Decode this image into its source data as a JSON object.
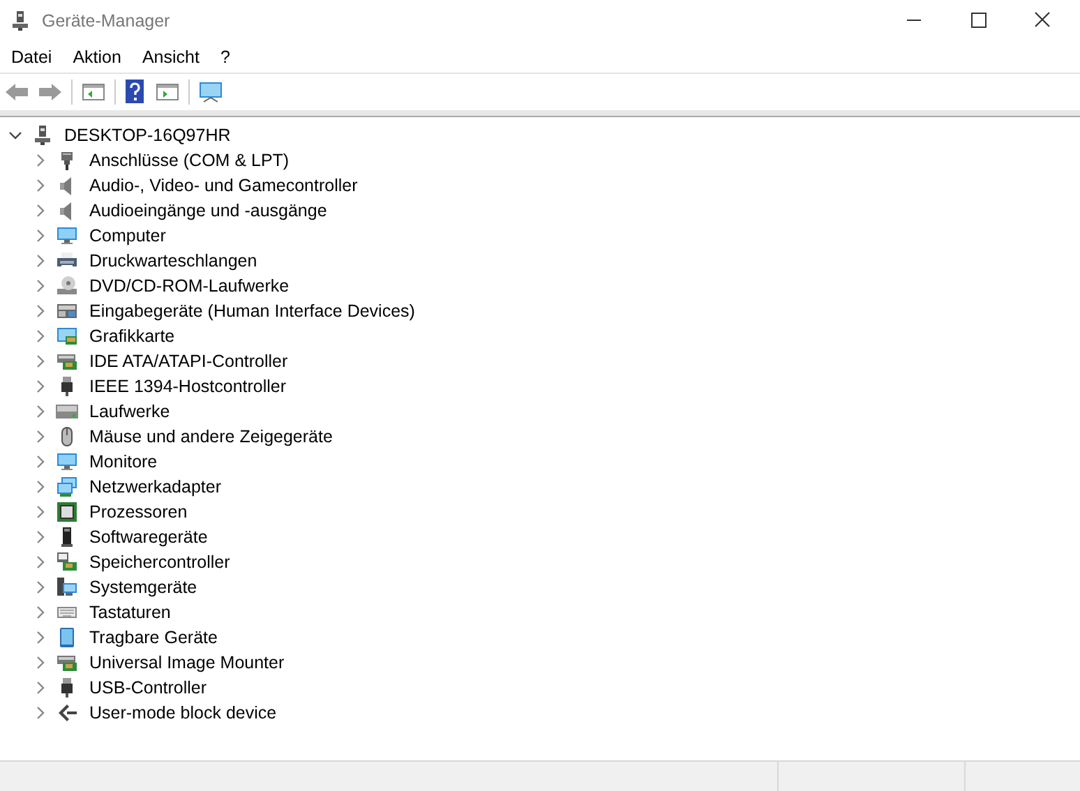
{
  "window": {
    "title": "Geräte-Manager"
  },
  "menu": [
    "Datei",
    "Aktion",
    "Ansicht",
    "?"
  ],
  "tree": {
    "label": "DESKTOP-16Q97HR",
    "kind": "computer",
    "expanded": true,
    "children": [
      {
        "label": "Anschlüsse (COM & LPT)",
        "kind": "port",
        "expanded": false
      },
      {
        "label": "Audio-, Video- und Gamecontroller",
        "kind": "speaker",
        "expanded": false
      },
      {
        "label": "Audioeingänge und -ausgänge",
        "kind": "speaker",
        "expanded": false
      },
      {
        "label": "Computer",
        "kind": "monitor",
        "expanded": false
      },
      {
        "label": "Druckwarteschlangen",
        "kind": "printer",
        "expanded": false
      },
      {
        "label": "DVD/CD-ROM-Laufwerke",
        "kind": "disc",
        "expanded": false
      },
      {
        "label": "Eingabegeräte (Human Interface Devices)",
        "kind": "hid",
        "expanded": false
      },
      {
        "label": "Grafikkarte",
        "kind": "display",
        "expanded": false
      },
      {
        "label": "IDE ATA/ATAPI-Controller",
        "kind": "card",
        "expanded": false
      },
      {
        "label": "IEEE 1394-Hostcontroller",
        "kind": "plug",
        "expanded": false
      },
      {
        "label": "Laufwerke",
        "kind": "drive",
        "expanded": false
      },
      {
        "label": "Mäuse und andere Zeigegeräte",
        "kind": "mouse",
        "expanded": false
      },
      {
        "label": "Monitore",
        "kind": "monitor",
        "expanded": false
      },
      {
        "label": "Netzwerkadapter",
        "kind": "network",
        "expanded": false
      },
      {
        "label": "Prozessoren",
        "kind": "cpu",
        "expanded": false
      },
      {
        "label": "Softwaregeräte",
        "kind": "software",
        "expanded": false
      },
      {
        "label": "Speichercontroller",
        "kind": "storage",
        "expanded": false
      },
      {
        "label": "Systemgeräte",
        "kind": "system",
        "expanded": false
      },
      {
        "label": "Tastaturen",
        "kind": "keyboard",
        "expanded": false
      },
      {
        "label": "Tragbare Geräte",
        "kind": "portable",
        "expanded": false
      },
      {
        "label": "Universal Image Mounter",
        "kind": "card",
        "expanded": false
      },
      {
        "label": "USB-Controller",
        "kind": "plug",
        "expanded": false
      },
      {
        "label": "User-mode block device",
        "kind": "block",
        "expanded": false
      }
    ]
  }
}
